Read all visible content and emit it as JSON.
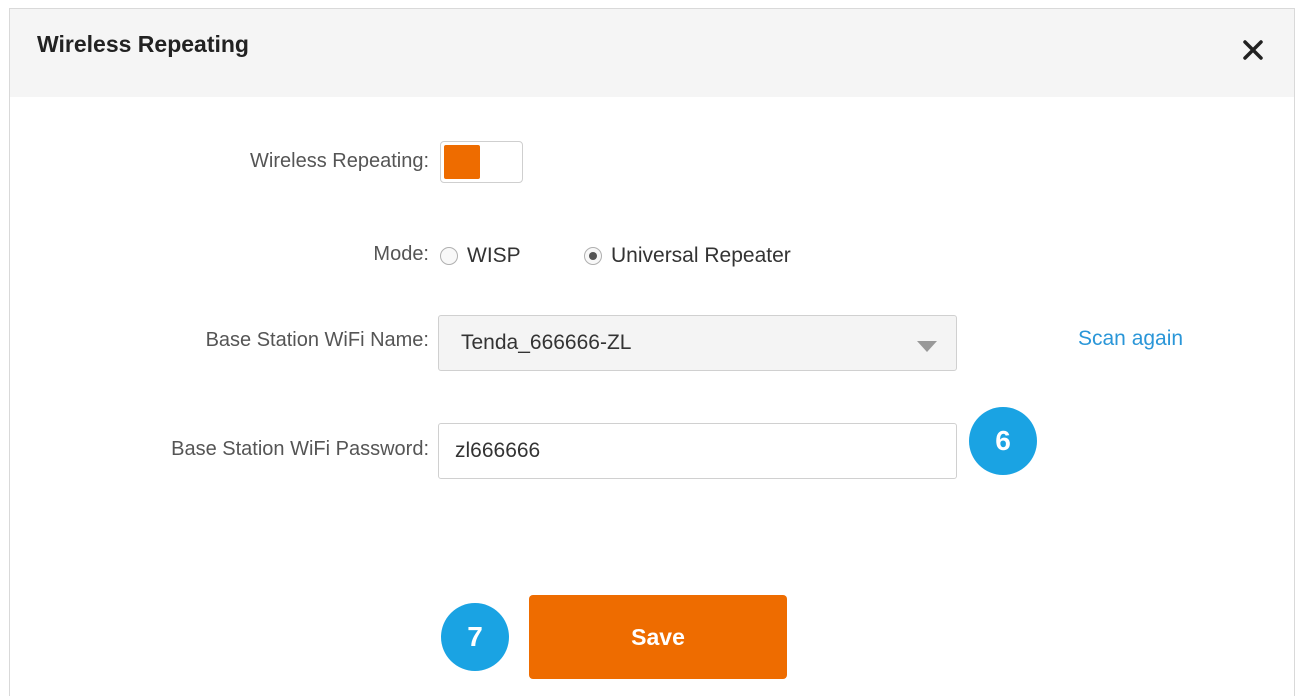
{
  "dialog": {
    "title": "Wireless Repeating",
    "close_icon": "close-icon"
  },
  "form": {
    "repeating_label": "Wireless Repeating:",
    "repeating_enabled": true,
    "mode_label": "Mode:",
    "mode_options": [
      {
        "label": "WISP",
        "selected": false
      },
      {
        "label": "Universal Repeater",
        "selected": true
      }
    ],
    "ssid_label": "Base Station WiFi Name:",
    "ssid_value": "Tenda_666666-ZL",
    "scan_again": "Scan again",
    "password_label": "Base Station WiFi Password:",
    "password_value": "zl666666"
  },
  "steps": {
    "password_step": "6",
    "save_step": "7"
  },
  "actions": {
    "save_label": "Save"
  },
  "colors": {
    "accent_orange": "#ee6c00",
    "badge_blue": "#1aa3e3",
    "link_blue": "#2a96d8"
  }
}
